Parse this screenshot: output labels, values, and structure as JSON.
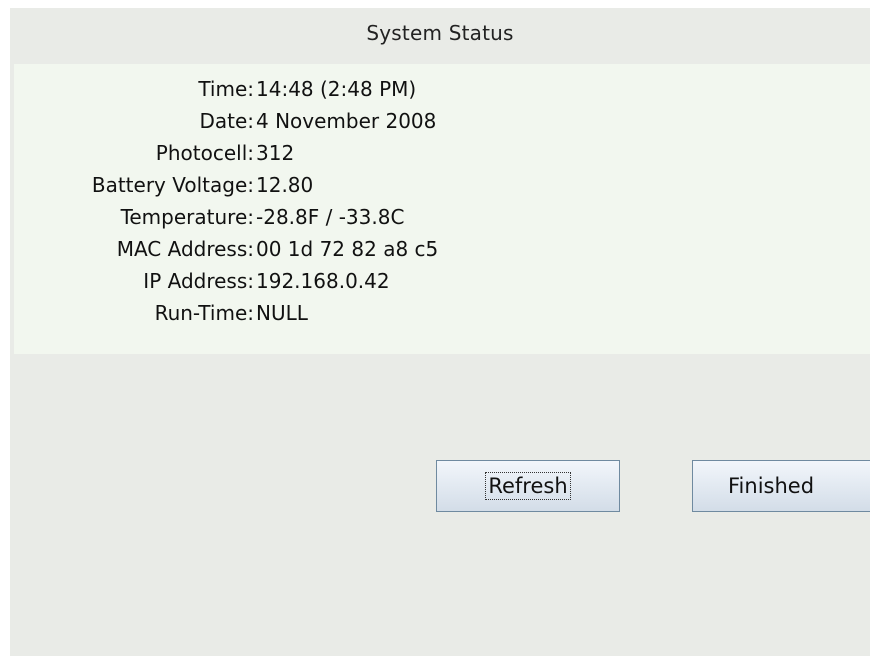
{
  "header": {
    "title": "System Status"
  },
  "status": {
    "rows": [
      {
        "label": "Time:",
        "value": "14:48 (2:48 PM)"
      },
      {
        "label": "Date:",
        "value": "4 November 2008"
      },
      {
        "label": "Photocell:",
        "value": "312"
      },
      {
        "label": "Battery Voltage:",
        "value": "12.80"
      },
      {
        "label": "Temperature:",
        "value": "-28.8F / -33.8C"
      },
      {
        "label": "MAC Address:",
        "value": "00 1d 72 82 a8 c5"
      },
      {
        "label": "IP Address:",
        "value": "192.168.0.42"
      },
      {
        "label": "Run-Time:",
        "value": "NULL"
      }
    ]
  },
  "buttons": {
    "refresh_label": "Refresh",
    "finished_label": "Finished"
  },
  "colors": {
    "panel_bg": "#e9ebe7",
    "status_bg": "#f2f7ef",
    "button_border": "#6f8aa0"
  }
}
